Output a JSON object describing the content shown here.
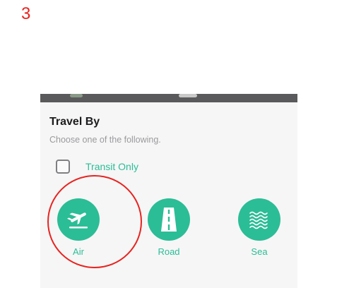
{
  "annotation": {
    "step_number": "3",
    "color": "#e8231f"
  },
  "sheet": {
    "title": "Travel By",
    "subtitle": "Choose one of the following.",
    "transit_only": {
      "label": "Transit Only",
      "checked": false
    },
    "modes": [
      {
        "label": "Air",
        "icon": "airplane-departure-icon"
      },
      {
        "label": "Road",
        "icon": "road-icon"
      },
      {
        "label": "Sea",
        "icon": "waves-icon"
      }
    ]
  },
  "colors": {
    "accent": "#2bbd96",
    "text": "#1c1c1e",
    "muted": "#9a9a9e"
  }
}
